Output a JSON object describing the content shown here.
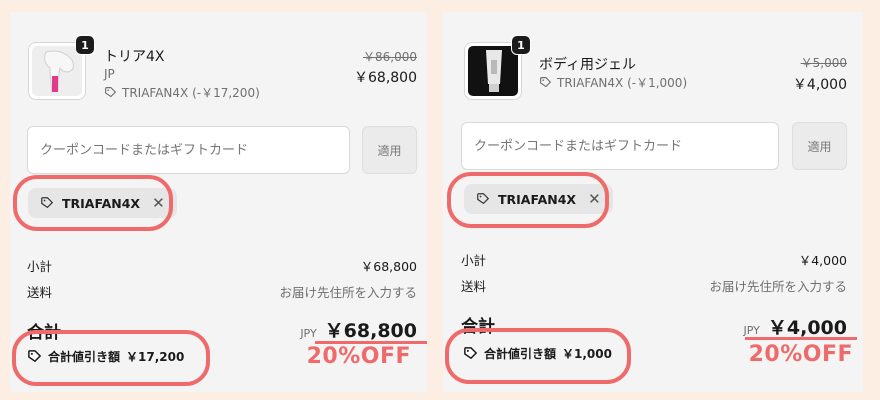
{
  "panels": [
    {
      "product": {
        "quantity": "1",
        "name": "トリア4X",
        "variant": "JP",
        "discount_line": "TRIAFAN4X (-￥17,200)",
        "original_price": "￥86,000",
        "price": "￥68,800"
      },
      "coupon": {
        "placeholder": "クーポンコードまたはギフトカード",
        "apply_label": "適用"
      },
      "applied_code": "TRIAFAN4X",
      "subtotal": {
        "label": "小計",
        "value": "￥68,800"
      },
      "shipping": {
        "label": "送料",
        "value": "お届け先住所を入力する"
      },
      "total": {
        "label": "合計",
        "currency": "JPY",
        "value": "￥68,800"
      },
      "savings": {
        "label": "合計値引き額",
        "value": "￥17,200"
      },
      "off_label": "20%OFF"
    },
    {
      "product": {
        "quantity": "1",
        "name": "ボディ用ジェル",
        "variant": "",
        "discount_line": "TRIAFAN4X (-￥1,000)",
        "original_price": "￥5,000",
        "price": "￥4,000"
      },
      "coupon": {
        "placeholder": "クーポンコードまたはギフトカード",
        "apply_label": "適用"
      },
      "applied_code": "TRIAFAN4X",
      "subtotal": {
        "label": "小計",
        "value": "￥4,000"
      },
      "shipping": {
        "label": "送料",
        "value": "お届け先住所を入力する"
      },
      "total": {
        "label": "合計",
        "currency": "JPY",
        "value": "￥4,000"
      },
      "savings": {
        "label": "合計値引き額",
        "value": "￥1,000"
      },
      "off_label": "20%OFF"
    }
  ],
  "colors": {
    "background": "#fdeee4",
    "panel": "#f4f4f4",
    "highlight": "#ef6b6b"
  },
  "icons": {
    "discount": "tag-icon",
    "remove": "close-icon"
  }
}
